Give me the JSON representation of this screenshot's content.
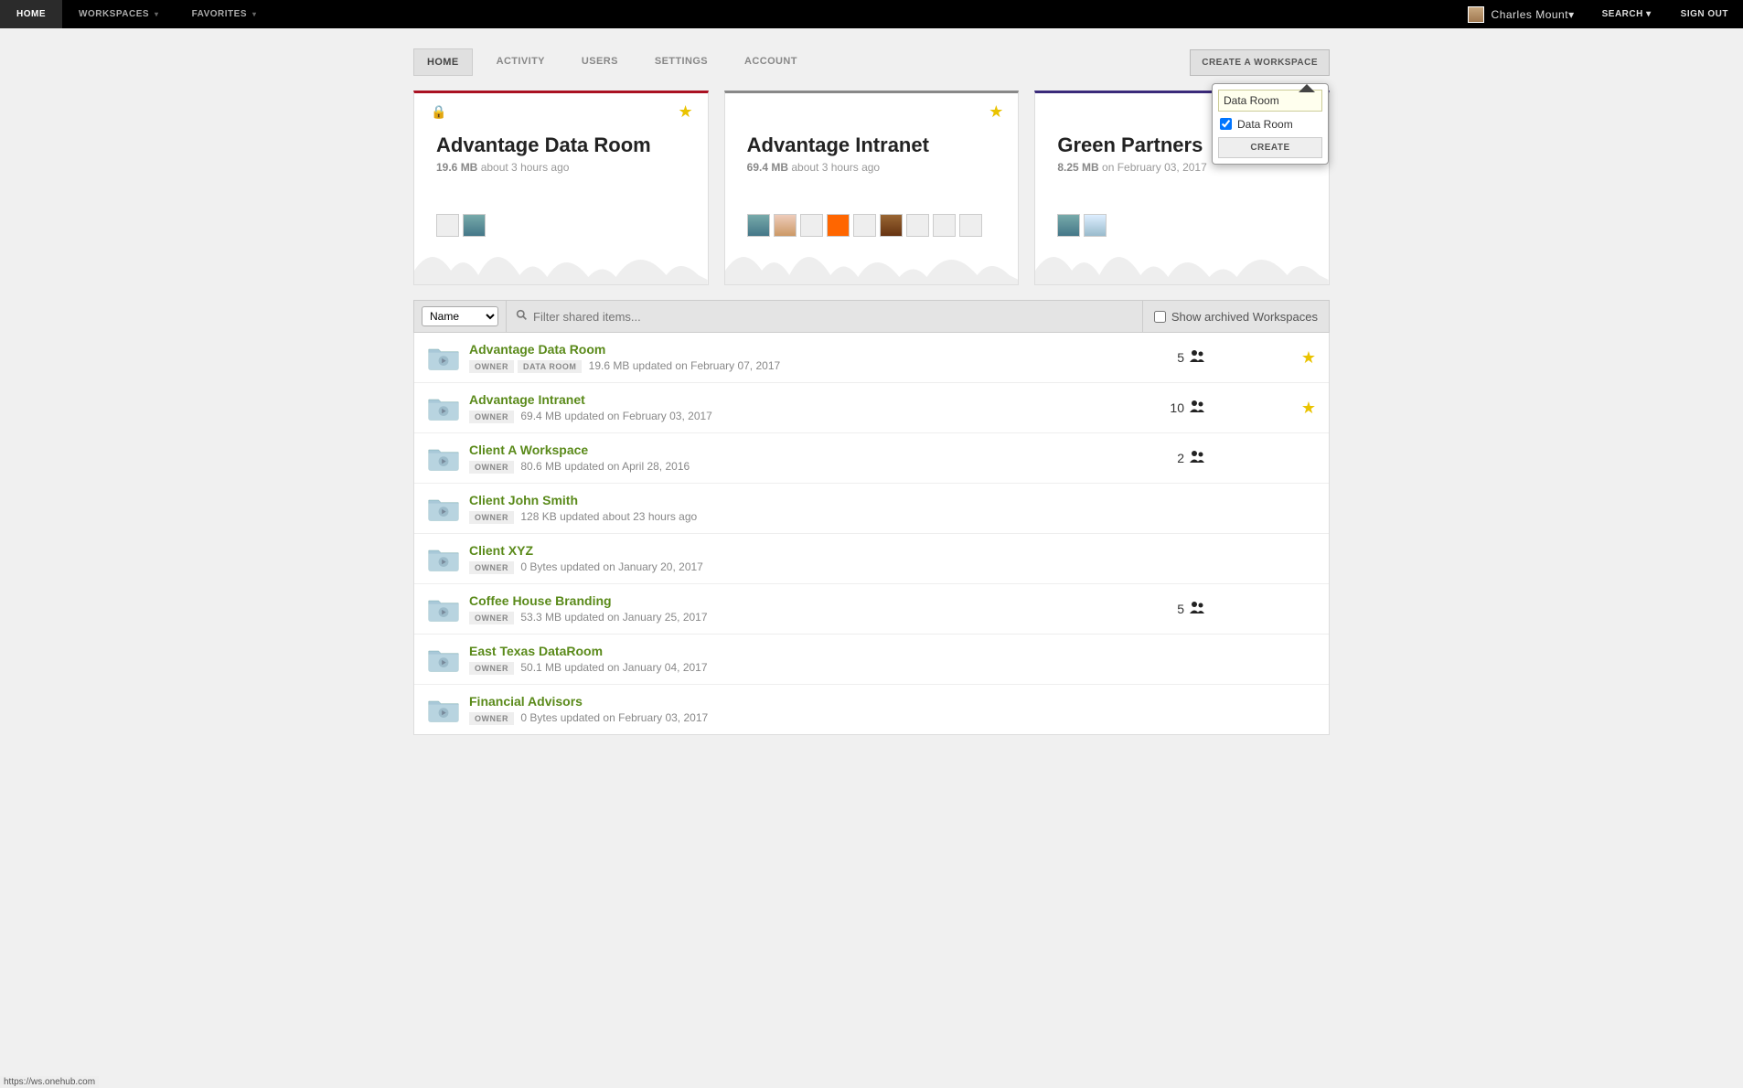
{
  "topnav": {
    "left": [
      {
        "label": "HOME",
        "active": true,
        "dropdown": false
      },
      {
        "label": "WORKSPACES",
        "active": false,
        "dropdown": true
      },
      {
        "label": "FAVORITES",
        "active": false,
        "dropdown": true
      }
    ],
    "user_name": "Charles Mount",
    "search_label": "SEARCH",
    "signout_label": "SIGN OUT"
  },
  "tabs": {
    "items": [
      "HOME",
      "ACTIVITY",
      "USERS",
      "SETTINGS",
      "ACCOUNT"
    ],
    "active_index": 0,
    "create_button": "CREATE A WORKSPACE"
  },
  "create_popover": {
    "input_value": "Data Room",
    "checkbox_label": "Data Room",
    "checkbox_checked": true,
    "submit_label": "CREATE"
  },
  "cards": [
    {
      "title": "Advantage Data Room",
      "size": "19.6 MB",
      "when": "about 3 hours ago",
      "locked": true,
      "starred": true,
      "color": "red",
      "avatars": [
        "blank",
        "c1"
      ]
    },
    {
      "title": "Advantage Intranet",
      "size": "69.4 MB",
      "when": "about 3 hours ago",
      "locked": false,
      "starred": true,
      "color": "gray",
      "avatars": [
        "c1",
        "c3",
        "blank",
        "c4",
        "blank",
        "c5",
        "blank",
        "blank",
        "blank"
      ]
    },
    {
      "title": "Green Partners",
      "size": "8.25 MB",
      "when": "on February 03, 2017",
      "locked": false,
      "starred": true,
      "color": "purple",
      "avatars": [
        "c1",
        "c2"
      ]
    }
  ],
  "filter": {
    "sort_value": "Name",
    "sort_options": [
      "Name"
    ],
    "search_placeholder": "Filter shared items...",
    "archived_label": "Show archived Workspaces"
  },
  "workspaces": [
    {
      "name": "Advantage Data Room",
      "badges": [
        "OWNER",
        "DATA ROOM"
      ],
      "size": "19.6 MB",
      "updated": "updated on February 07, 2017",
      "members": 5,
      "starred": true
    },
    {
      "name": "Advantage Intranet",
      "badges": [
        "OWNER"
      ],
      "size": "69.4 MB",
      "updated": "updated on February 03, 2017",
      "members": 10,
      "starred": true
    },
    {
      "name": "Client A Workspace",
      "badges": [
        "OWNER"
      ],
      "size": "80.6 MB",
      "updated": "updated on April 28, 2016",
      "members": 2,
      "starred": false
    },
    {
      "name": "Client John Smith",
      "badges": [
        "OWNER"
      ],
      "size": "128 KB",
      "updated": "updated about 23 hours ago",
      "members": null,
      "starred": false
    },
    {
      "name": "Client XYZ",
      "badges": [
        "OWNER"
      ],
      "size": "0 Bytes",
      "updated": "updated on January 20, 2017",
      "members": null,
      "starred": false
    },
    {
      "name": "Coffee House Branding",
      "badges": [
        "OWNER"
      ],
      "size": "53.3 MB",
      "updated": "updated on January 25, 2017",
      "members": 5,
      "starred": false
    },
    {
      "name": "East Texas DataRoom",
      "badges": [
        "OWNER"
      ],
      "size": "50.1 MB",
      "updated": "updated on January 04, 2017",
      "members": null,
      "starred": false
    },
    {
      "name": "Financial Advisors",
      "badges": [
        "OWNER"
      ],
      "size": "0 Bytes",
      "updated": "updated on February 03, 2017",
      "members": null,
      "starred": false
    }
  ],
  "statusbar_text": "https://ws.onehub.com"
}
